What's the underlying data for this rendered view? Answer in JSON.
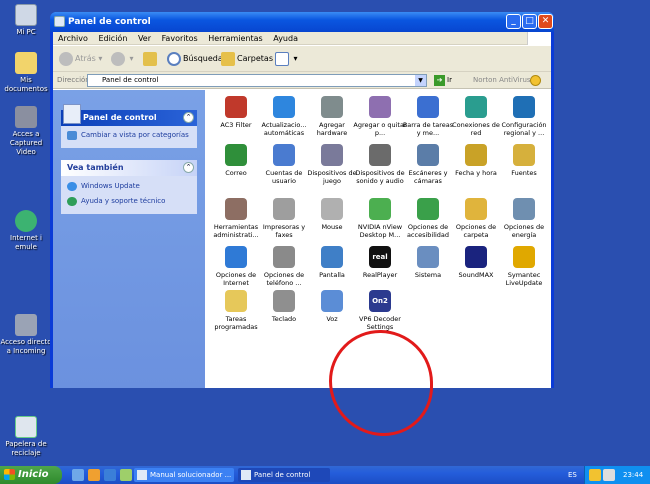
{
  "desktop": {
    "icons": [
      {
        "label": "Mi PC"
      },
      {
        "label": "Mis documentos"
      },
      {
        "label": "Acces a Captured Video"
      },
      {
        "label": "Internet i emule"
      },
      {
        "label": "Acceso directo a Incoming"
      },
      {
        "label": "Papelera de reciclaje"
      }
    ]
  },
  "window": {
    "title": "Panel de control",
    "menu": [
      "Archivo",
      "Edición",
      "Ver",
      "Favoritos",
      "Herramientas",
      "Ayuda"
    ],
    "toolbar": {
      "back": "Atrás",
      "search": "Búsqueda",
      "folders": "Carpetas"
    },
    "address": {
      "label": "Dirección",
      "value": "Panel de control",
      "go": "Ir",
      "norton": "Norton AntiVirus"
    },
    "left_pane": {
      "main_title": "Panel de control",
      "switch_view": "Cambiar a vista por categorías",
      "see_also_title": "Vea también",
      "see_also": [
        "Windows Update",
        "Ayuda y soporte técnico"
      ]
    },
    "items": [
      {
        "label": "AC3 Filter",
        "color": "#c0392b"
      },
      {
        "label": "Actualizacio... automáticas",
        "color": "#2e86de"
      },
      {
        "label": "Agregar hardware",
        "color": "#7f8c8d"
      },
      {
        "label": "Agregar o quitar p...",
        "color": "#8e6fb0"
      },
      {
        "label": "Barra de tareas y me...",
        "color": "#3b6fd1"
      },
      {
        "label": "Conexiones de red",
        "color": "#2a9d8f"
      },
      {
        "label": "Configuración regional y ...",
        "color": "#1f6fb5"
      },
      {
        "label": "Correo",
        "color": "#2f8f3a"
      },
      {
        "label": "Cuentas de usuario",
        "color": "#4a7bd0"
      },
      {
        "label": "Dispositivos de juego",
        "color": "#7a7a9a"
      },
      {
        "label": "Dispositivos de sonido y audio",
        "color": "#6b6b6b"
      },
      {
        "label": "Escáneres y cámaras",
        "color": "#5b7da8"
      },
      {
        "label": "Fecha y hora",
        "color": "#c9a227"
      },
      {
        "label": "Fuentes",
        "color": "#d6b03c"
      },
      {
        "label": "Herramientas administrati...",
        "color": "#8d6e63"
      },
      {
        "label": "Impresoras y faxes",
        "color": "#9e9e9e"
      },
      {
        "label": "Mouse",
        "color": "#b0b0b0"
      },
      {
        "label": "NVIDIA nView Desktop M...",
        "color": "#4caf50"
      },
      {
        "label": "Opciones de accesibilidad",
        "color": "#3aa04a"
      },
      {
        "label": "Opciones de carpeta",
        "color": "#e0b43c"
      },
      {
        "label": "Opciones de energía",
        "color": "#6f8fb0"
      },
      {
        "label": "Opciones de Internet",
        "color": "#2f7ad6"
      },
      {
        "label": "Opciones de teléfono ...",
        "color": "#8a8a8a"
      },
      {
        "label": "Pantalla",
        "color": "#3f7fc7"
      },
      {
        "label": "RealPlayer",
        "color": "#111111",
        "badge": "real"
      },
      {
        "label": "Sistema",
        "color": "#6a8ec0"
      },
      {
        "label": "SoundMAX",
        "color": "#1a237e"
      },
      {
        "label": "Symantec LiveUpdate",
        "color": "#e0a800"
      },
      {
        "label": "Tareas programadas",
        "color": "#e6c85a"
      },
      {
        "label": "Teclado",
        "color": "#8f8f8f"
      },
      {
        "label": "Voz",
        "color": "#5b8dd6"
      },
      {
        "label": "VP6 Decoder Settings",
        "color": "#2b3a8f",
        "badge": "On2"
      }
    ]
  },
  "taskbar": {
    "start": "Inicio",
    "tasks": [
      "Manual solucionador ...",
      "Panel de control"
    ],
    "language": "ES",
    "clock": "23:44"
  }
}
